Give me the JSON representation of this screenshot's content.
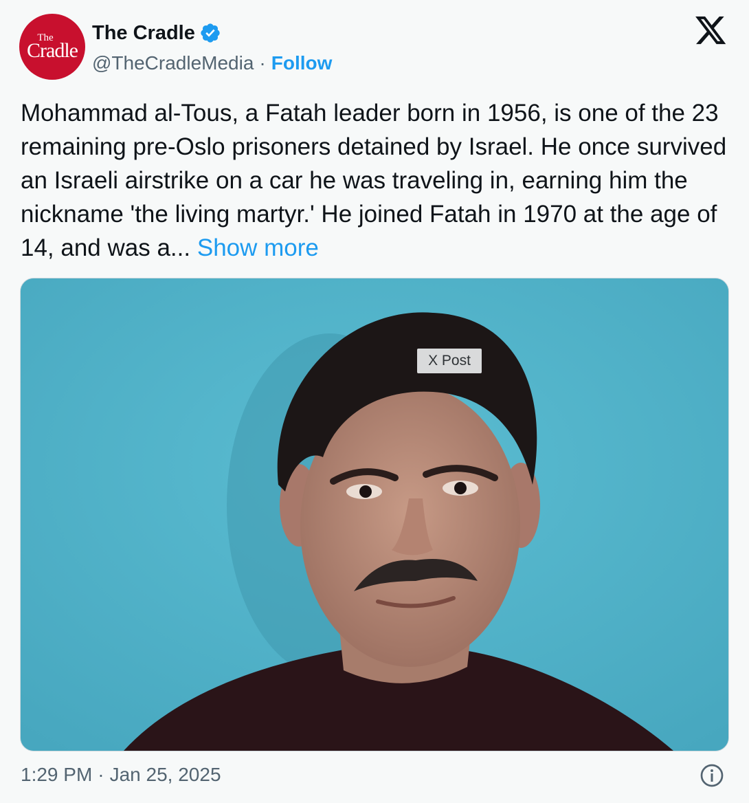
{
  "author": {
    "avatar_logo_top": "The",
    "avatar_logo_bottom": "Cradle",
    "display_name": "The Cradle",
    "handle": "@TheCradleMedia",
    "separator": "·",
    "follow_label": "Follow",
    "verified_icon": "verified-badge-icon"
  },
  "platform_logo": "x-logo-icon",
  "tweet": {
    "text": "Mohammad al-Tous, a Fatah leader born in 1956, is one of the 23 remaining pre-Oslo prisoners detained by Israel. He once survived an Israeli airstrike on a car he was traveling in, earning him the nickname 'the living martyr.' He joined Fatah in 1970 at the age of 14, and was a...",
    "show_more_label": "Show more"
  },
  "media": {
    "badge": "X Post"
  },
  "footer": {
    "time": "1:29 PM",
    "separator": "·",
    "date": "Jan 25, 2025",
    "info_icon": "info-icon"
  },
  "colors": {
    "accent": "#1d9bf0",
    "avatar_bg": "#c8102e",
    "photo_bg": "#55b6cc",
    "secondary_text": "#536471"
  }
}
